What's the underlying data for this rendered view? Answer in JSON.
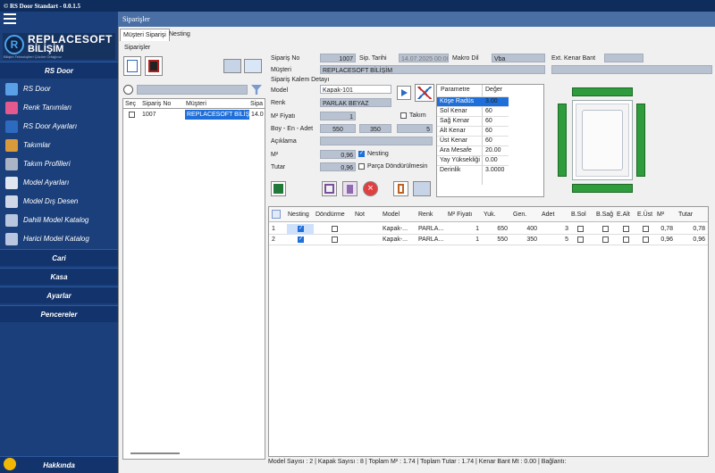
{
  "app": {
    "title": "© RS Door Standart - 0.0.1.5"
  },
  "sidebar": {
    "logo_main": "REPLACESOFT",
    "logo_sub": "BİLİŞİM",
    "logo_tag": "Bilişim Teknolojileri Çözüm Ortağınız",
    "section_rsdoor": "RS Door",
    "items": [
      {
        "label": "RS Door",
        "icon": "door-icon",
        "color": "#5aa0e6"
      },
      {
        "label": "Renk Tanımları",
        "icon": "color-wheel-icon",
        "color": "#e45a8e"
      },
      {
        "label": "RS Door Ayarları",
        "icon": "gear-icon",
        "color": "#2c6bc0"
      },
      {
        "label": "Takımlar",
        "icon": "tools-icon",
        "color": "#d89a3a"
      },
      {
        "label": "Takım Profilleri",
        "icon": "profile-icon",
        "color": "#aab4c4"
      },
      {
        "label": "Model Ayarları",
        "icon": "wrench-cross-icon",
        "color": "#e0e6f0"
      },
      {
        "label": "Model Dış Desen",
        "icon": "pattern-icon",
        "color": "#d0d8e8"
      },
      {
        "label": "Dahili Model Katalog",
        "icon": "catalog-icon",
        "color": "#b8c6e0"
      },
      {
        "label": "Harici Model Katalog",
        "icon": "catalog-icon",
        "color": "#b8c6e0"
      }
    ],
    "sections": [
      "Cari",
      "Kasa",
      "Ayarlar",
      "Pencereler"
    ],
    "footer": "Hakkında"
  },
  "main": {
    "header": "Siparişler",
    "tabs": [
      "Müşteri Siparişi",
      "Nesting"
    ],
    "panel_title": "Siparişler",
    "order_list": {
      "headers": [
        "Seç",
        "Sipariş No",
        "Müşteri",
        "Sipa"
      ],
      "rows": [
        {
          "no": "1007",
          "customer": "REPLACESOFT BİLİŞİM",
          "extra": "14.0"
        }
      ]
    },
    "form": {
      "siparis_no_label": "Sipariş No",
      "siparis_no": "1007",
      "sip_tarihi_label": "Sip. Tarihi",
      "sip_tarihi": "14.07.2025 00:00",
      "makro_dil_label": "Makro Dil",
      "makro_dil": "Vba",
      "ext_kenar_label": "Ext. Kenar Bant",
      "musteri_label": "Müşteri",
      "musteri": "REPLACESOFT BİLİŞİM",
      "kalem_detay_label": "Sipariş Kalem Detayı",
      "model_label": "Model",
      "model": "Kapak-101",
      "renk_label": "Renk",
      "renk": "PARLAK BEYAZ",
      "m2_fiyati_label": "M² Fiyatı",
      "m2_fiyati": "1",
      "takim_label": "Takım",
      "boy_en_adet_label": "Boy - En - Adet",
      "boy": "550",
      "en": "350",
      "adet": "5",
      "aciklama_label": "Açıklama",
      "m2_label": "M²",
      "m2": "0,96",
      "nesting_label": "Nesting",
      "tutar_label": "Tutar",
      "tutar": "0,96",
      "parca_label": "Parça Döndürülmesin"
    },
    "params": {
      "headers": [
        "Parametre",
        "Değer"
      ],
      "rows": [
        [
          "Köşe Radüs",
          "3.00"
        ],
        [
          "Sol Kenar",
          "60"
        ],
        [
          "Sağ Kenar",
          "60"
        ],
        [
          "Alt Kenar",
          "60"
        ],
        [
          "Üst Kenar",
          "60"
        ],
        [
          "Ara Mesafe",
          "20.00"
        ],
        [
          "Yay Yüksekliği",
          "0.00"
        ],
        [
          "Derinlik",
          "3.0000"
        ]
      ]
    },
    "grid": {
      "headers": [
        "Nesting",
        "Döndürme",
        "Not",
        "Model",
        "Renk",
        "M² Fiyatı",
        "Yuk.",
        "Gen.",
        "Adet",
        "B.Sol",
        "B.Sağ",
        "E.Alt",
        "E.Üst",
        "M²",
        "Tutar"
      ],
      "rows": [
        {
          "idx": "1",
          "nesting": true,
          "model": "Kapak-...",
          "renk": "PARLA...",
          "fiyat": "1",
          "yuk": "650",
          "gen": "400",
          "adet": "3",
          "m2": "0,78",
          "tutar": "0,78"
        },
        {
          "idx": "2",
          "nesting": true,
          "model": "Kapak-...",
          "renk": "PARLA...",
          "fiyat": "1",
          "yuk": "550",
          "gen": "350",
          "adet": "5",
          "m2": "0,96",
          "tutar": "0,96"
        }
      ]
    },
    "status": {
      "text": "Model Sayısı :  2  | Kapak Sayısı :  8  | Toplam M² :  1.74  | Toplam Tutar :  1.74  | Kenar Bant Mt :  0.00  | Bağlantı:"
    }
  },
  "colors": {
    "sidebar": "#1b3f7a",
    "header": "#4a6fa5",
    "accent": "#1e6fd9",
    "green": "#2e9b3c"
  }
}
